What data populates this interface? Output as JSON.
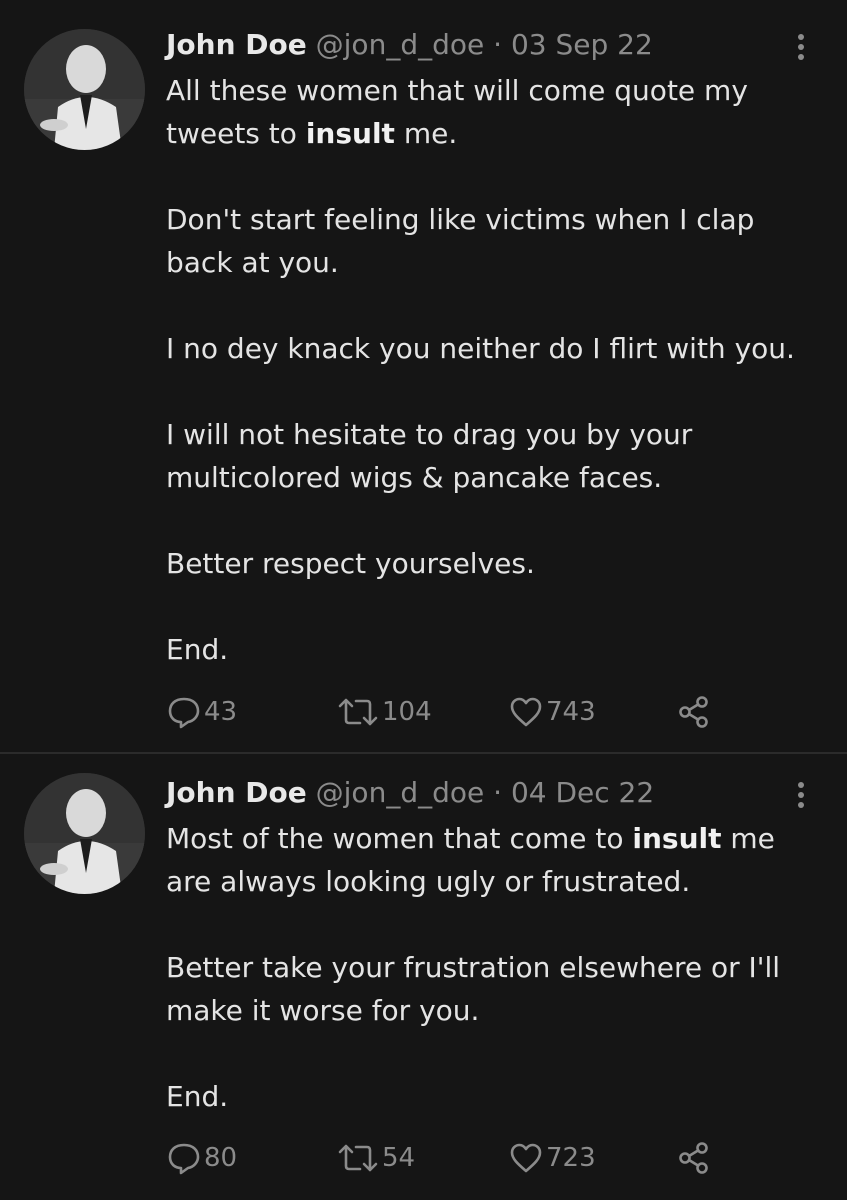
{
  "tweets": [
    {
      "author": {
        "name": "John Doe",
        "handle": "@jon_d_doe"
      },
      "separator": "·",
      "date": "03 Sep 22",
      "paragraphs": [
        {
          "before": "All these women that will come quote my tweets to ",
          "bold": "insult",
          "after": " me."
        },
        {
          "before": "Don't start feeling like victims when I clap back at you.",
          "bold": "",
          "after": ""
        },
        {
          "before": "I no dey knack you neither do I flirt with you.",
          "bold": "",
          "after": ""
        },
        {
          "before": "I will not hesitate to drag you by your multicolored wigs & pancake faces.",
          "bold": "",
          "after": ""
        },
        {
          "before": "Better respect yourselves.",
          "bold": "",
          "after": ""
        },
        {
          "before": "End.",
          "bold": "",
          "after": ""
        }
      ],
      "stats": {
        "replies": "43",
        "retweets": "104",
        "likes": "743"
      }
    },
    {
      "author": {
        "name": "John Doe",
        "handle": "@jon_d_doe"
      },
      "separator": "·",
      "date": "04 Dec 22",
      "paragraphs": [
        {
          "before": "Most of the women that come to ",
          "bold": "insult",
          "after": " me are always looking ugly or frustrated."
        },
        {
          "before": "Better take your frustration elsewhere or I'll make it worse for you.",
          "bold": "",
          "after": ""
        },
        {
          "before": "End.",
          "bold": "",
          "after": ""
        }
      ],
      "stats": {
        "replies": "80",
        "retweets": "54",
        "likes": "723"
      }
    }
  ],
  "icons": {
    "reply": "reply-icon",
    "retweet": "retweet-icon",
    "like": "heart-icon",
    "share": "share-icon",
    "more": "more-vertical-icon"
  },
  "colors": {
    "background": "#151515",
    "text": "#e4e4e4",
    "muted": "#8b8b8b",
    "divider": "#2b2b2b"
  }
}
